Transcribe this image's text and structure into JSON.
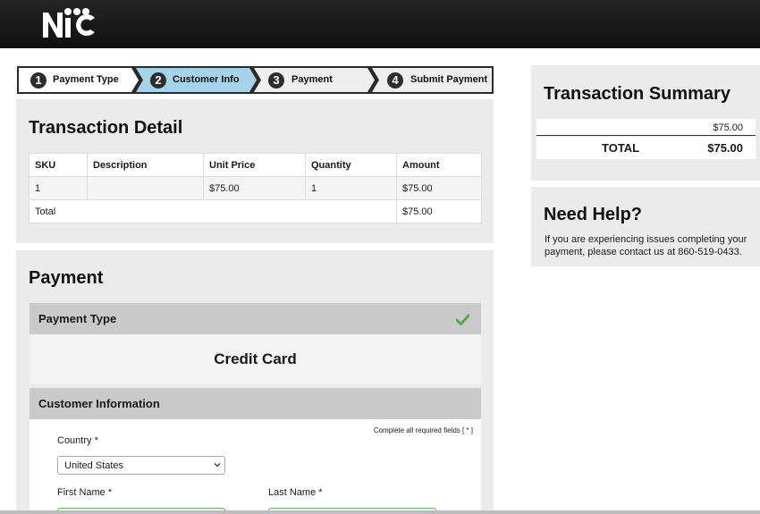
{
  "header": {
    "logo_text": "NIC"
  },
  "stepper": [
    {
      "num": "1",
      "label": "Payment Type"
    },
    {
      "num": "2",
      "label": "Customer Info"
    },
    {
      "num": "3",
      "label": "Payment"
    },
    {
      "num": "4",
      "label": "Submit Payment"
    }
  ],
  "detail": {
    "title": "Transaction Detail",
    "columns": [
      "SKU",
      "Description",
      "Unit Price",
      "Quantity",
      "Amount"
    ],
    "row": {
      "sku": "1",
      "description": "",
      "unit_price": "$75.00",
      "quantity": "1",
      "amount": "$75.00"
    },
    "total_label": "Total",
    "total_amount": "$75.00"
  },
  "payment": {
    "title": "Payment",
    "payment_type_heading": "Payment Type",
    "payment_type_value": "Credit Card",
    "customer_heading": "Customer Information",
    "required_note": "Complete all required fields [ * ]",
    "country_label": "Country *",
    "country_value": "United States",
    "first_name_label": "First Name *",
    "last_name_label": "Last Name *"
  },
  "summary": {
    "title": "Transaction Summary",
    "line_amount": "$75.00",
    "total_label": "TOTAL",
    "total_amount": "$75.00"
  },
  "help": {
    "title": "Need Help?",
    "text": "If you are experiencing issues completing your payment, please contact us at 860-519-0433."
  },
  "colors": {
    "step_active": "#ffffff",
    "step_light": "#a6d3ea",
    "step_mid": "#eeeeee",
    "check": "#5aa64b"
  }
}
